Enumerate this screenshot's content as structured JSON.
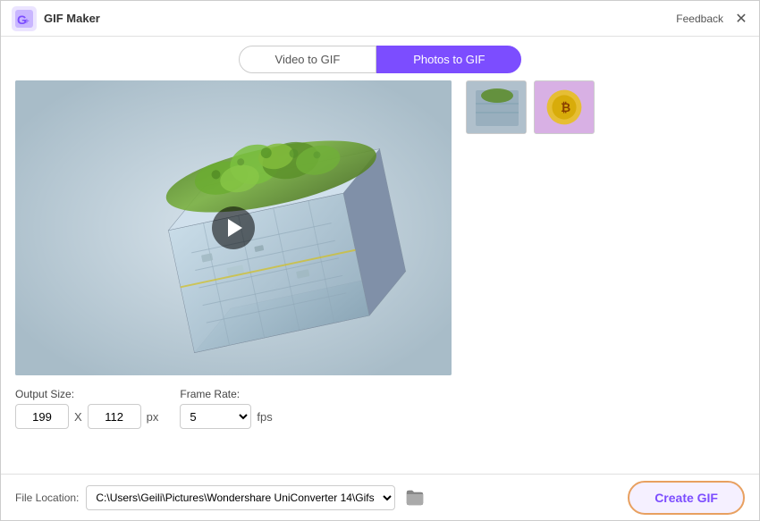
{
  "app": {
    "title": "GIF Maker",
    "feedback_label": "Feedback"
  },
  "tabs": [
    {
      "id": "video-to-gif",
      "label": "Video to GIF",
      "active": false
    },
    {
      "id": "photos-to-gif",
      "label": "Photos to GIF",
      "active": true
    }
  ],
  "preview": {
    "play_button_title": "Play"
  },
  "settings": {
    "output_size_label": "Output Size:",
    "width_value": "199",
    "height_value": "112",
    "px_label": "px",
    "x_label": "X",
    "frame_rate_label": "Frame Rate:",
    "fps_value": "5",
    "fps_label": "fps"
  },
  "file_location": {
    "label": "File Location:",
    "path": "C:\\Users\\Geili\\Pictures\\Wondershare UniConverter 14\\Gifs"
  },
  "actions": {
    "create_gif_label": "Create GIF"
  },
  "icons": {
    "close": "✕",
    "folder": "📁",
    "app_icon": "purple square icon"
  }
}
